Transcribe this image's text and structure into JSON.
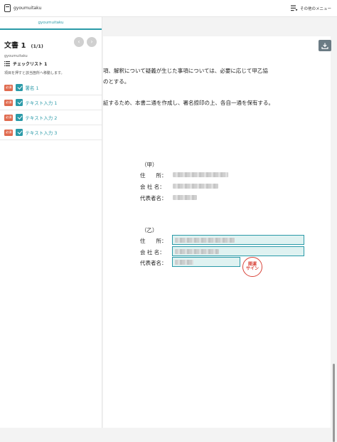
{
  "header": {
    "brand": "gyoumuitaku",
    "other_menu": "その他のメニュー"
  },
  "sidebar": {
    "tab": "gyoumuitaku",
    "doc_title": "文書 1",
    "doc_count": "(1/1)",
    "doc_sub": "gyoumuitaku",
    "checklist_title": "チェックリスト 1",
    "checklist_desc": "項目を押すと該当箇所へ移動します。",
    "items": [
      {
        "badge": "必須",
        "label": "署名 1"
      },
      {
        "badge": "必須",
        "label": "テキスト入力 1"
      },
      {
        "badge": "必須",
        "label": "テキスト入力 2"
      },
      {
        "badge": "必須",
        "label": "テキスト入力 3"
      }
    ]
  },
  "document": {
    "line1": "項、解釈について疑義が生じた事項については、必要に応じて甲乙協",
    "line2": "のとする。",
    "line3": "証するため、本書二通を作成し、署名捺印の上、各自一通を保有する。",
    "party_a": {
      "label": "（甲）",
      "address_label": "住　　所：",
      "company_label": "会 社 名：",
      "rep_label": "代表者名："
    },
    "party_b": {
      "label": "（乙）",
      "address_label": "住　　所：",
      "company_label": "会 社 名：",
      "rep_label": "代表者名："
    },
    "stamp_line1": "開運",
    "stamp_line2": "サイン"
  },
  "colors": {
    "accent": "#2a9aa8",
    "badge": "#e06a4e",
    "stamp": "#d9443a"
  }
}
